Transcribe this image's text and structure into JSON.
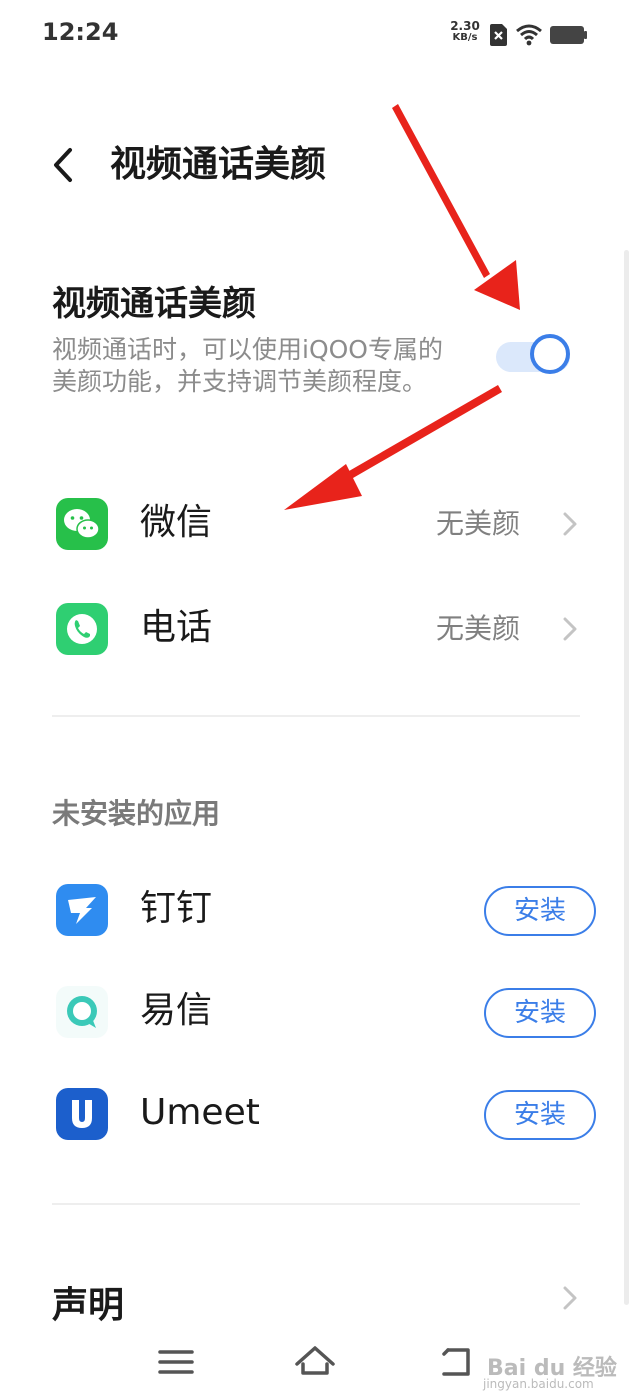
{
  "status_bar": {
    "time": "12:24",
    "net_speed": "2.30",
    "net_unit": "KB/s",
    "icons": [
      "sim-x-icon",
      "wifi-icon",
      "battery-icon"
    ]
  },
  "header": {
    "back_icon": "chevron-left-icon",
    "title": "视频通话美颜"
  },
  "feature": {
    "title": "视频通话美颜",
    "description": "视频通话时，可以使用iQOO专属的美颜功能，并支持调节美颜程度。",
    "toggle_on": true
  },
  "installed_apps": [
    {
      "name": "微信",
      "value": "无美颜",
      "icon": "wechat-icon",
      "color": "#27c04a"
    },
    {
      "name": "电话",
      "value": "无美颜",
      "icon": "phone-icon",
      "color": "#2fcf72"
    }
  ],
  "uninstalled_section": {
    "title": "未安装的应用",
    "install_label": "安装",
    "apps": [
      {
        "name": "钉钉",
        "icon": "dingtalk-icon",
        "color": "#2f8cf0"
      },
      {
        "name": "易信",
        "icon": "yixin-icon",
        "color": "#3bc9b8"
      },
      {
        "name": "Umeet",
        "icon": "umeet-icon",
        "color": "#1c5fcc"
      }
    ]
  },
  "statement": {
    "label": "声明"
  },
  "nav_bar": {
    "icons": [
      "menu-icon",
      "home-icon",
      "back-icon"
    ]
  },
  "watermark": {
    "text": "Bai du 经验",
    "sub": "jingyan.baidu.com"
  },
  "colors": {
    "accent": "#3b7ee8",
    "annotation_arrow": "#e8231b"
  }
}
